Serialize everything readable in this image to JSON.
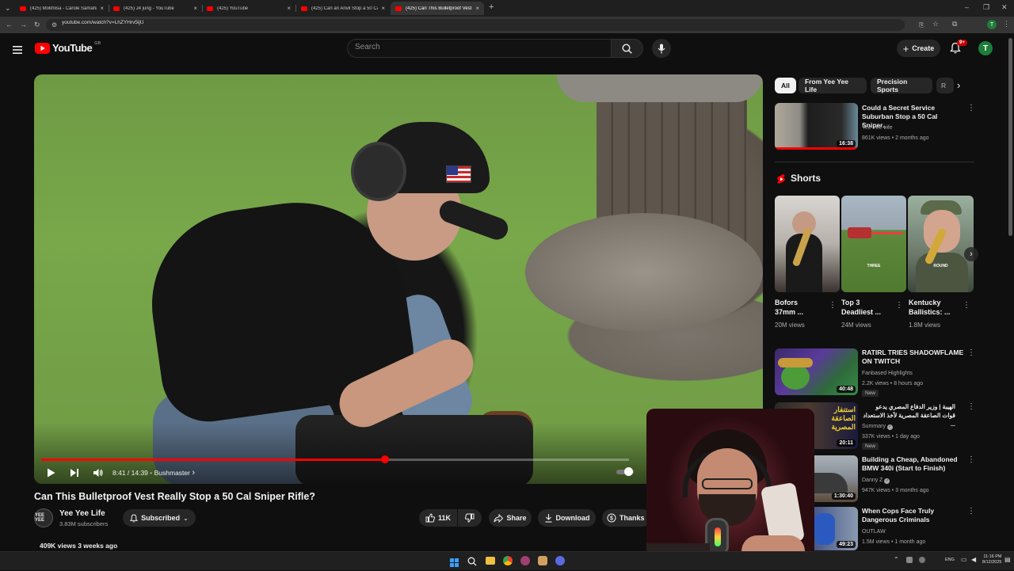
{
  "browser": {
    "tabs": [
      {
        "title": "(425) Mokhlisa - Carole Samaha"
      },
      {
        "title": "(425) J4 jung - YouTube"
      },
      {
        "title": "(425) YouTube"
      },
      {
        "title": "(425) Can an Anvil Stop a 50 Cal"
      },
      {
        "title": "(425) Can This Bulletproof Vest"
      }
    ],
    "url": "youtube.com/watch?v=LhZYHrv5ijU",
    "profile_initial": "T"
  },
  "header": {
    "logo_text": "YouTube",
    "logo_region": "GB",
    "search_placeholder": "Search",
    "create_label": "Create",
    "notif_count": "9+",
    "avatar_initial": "T"
  },
  "player": {
    "progress_fraction": 0.5846,
    "time": "8:41 / 14:39",
    "chapter": "Bushmaster",
    "chapter_arrow": "›"
  },
  "video": {
    "title": "Can This Bulletproof Vest Really Stop a 50 Cal Sniper Rifle?",
    "channel_avatar": "YEE YEE",
    "channel": "Yee Yee Life",
    "subscribers": "3.83M subscribers",
    "subscribed_label": "Subscribed",
    "likes": "11K",
    "share_label": "Share",
    "download_label": "Download",
    "thanks_label": "Thanks",
    "views_line": "409K views  3 weeks ago"
  },
  "sidebar": {
    "chips": [
      "All",
      "From Yee Yee Life",
      "Precision Sports",
      "R"
    ],
    "first": {
      "title_line1": "Could a Secret Service",
      "title_line2": "Suburban Stop a 50 Cal Sniper...",
      "channel": "Yee Yee Life",
      "meta": "861K views • 2 months ago",
      "duration": "16:38"
    },
    "shorts_label": "Shorts",
    "shorts": [
      {
        "title_line1": "Bofors",
        "title_line2": "37mm ...",
        "views": "20M views"
      },
      {
        "title_line1": "Top 3",
        "title_line2": "Deadliest ...",
        "views": "24M views"
      },
      {
        "title_line1": "Kentucky",
        "title_line2": "Ballistics: ...",
        "views": "1.8M views"
      }
    ],
    "shorts_thumb_text": [
      "THREE",
      "ROUND"
    ],
    "videos": [
      {
        "title_line1": "RATIRL TRIES SHADOWFLAME",
        "title_line2": "ON TWITCH",
        "channel": "Fanbased Highlights",
        "meta": "2.2K views • 8 hours ago",
        "badge": "New",
        "duration": "40:48"
      },
      {
        "title_line1": "الهيبة | وزير الدفاع المصري يدعو",
        "title_line2": "قوات الصاعقة المصرية لأخذ الاستعداد ...",
        "channel": "Summary",
        "meta": "337K views • 1 day ago",
        "badge": "New",
        "duration": "20:11",
        "thumb_text": "استنفار الصاعقة المصرية"
      },
      {
        "title_line1": "Building a Cheap, Abandoned",
        "title_line2": "BMW 340i (Start to Finish)",
        "channel": "Danny Z",
        "meta": "947K views • 3 months ago",
        "duration": "1:30:40"
      },
      {
        "title_line1": "When Cops Face Truly",
        "title_line2": "Dangerous Criminals",
        "channel": "OUTLAW",
        "meta": "1.5M views • 1 month ago",
        "duration": "49:23"
      }
    ]
  },
  "taskbar": {
    "lang": "ENG",
    "time": "11:16 PM",
    "date": "8/12/2025"
  },
  "colors": {
    "accent": "#ff0000",
    "background": "#0f0f0f",
    "surface": "#272727"
  }
}
